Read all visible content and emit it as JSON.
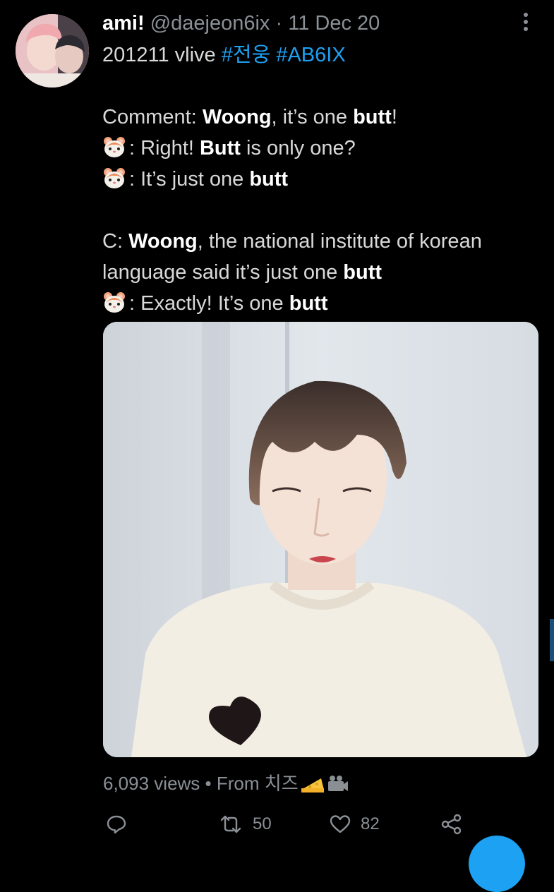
{
  "tweet": {
    "display_name": "ami!",
    "handle": "@daejeon6ix",
    "separator": "·",
    "date": "11 Dec 20",
    "line1_prefix": "201211 vlive",
    "hashtag1": "#전웅",
    "hashtag2": "#AB6IX",
    "dialogue1": {
      "comment_label": "Comment:",
      "comment_name": "Woong",
      "comment_mid": ", it’s one",
      "comment_word": "butt",
      "comment_end": "!",
      "reply1_pre": ": Right!",
      "reply1_word": "Butt",
      "reply1_post": "is only one?",
      "reply2_pre": ": It’s just one",
      "reply2_word": "butt"
    },
    "dialogue2": {
      "c_label": "C:",
      "c_name": "Woong",
      "c_rest": ", the national institute of korean",
      "c_line2_pre": "language said it’s just one",
      "c_line2_word": "butt",
      "reply_pre": ": Exactly! It’s one",
      "reply_word": "butt"
    },
    "reply_emoji": "hamster-face-icon"
  },
  "meta": {
    "views": "6,093 views",
    "bullet": "•",
    "source_prefix": "From",
    "source_name": "치즈",
    "source_icons": [
      "cheese-icon",
      "movie-camera-icon"
    ]
  },
  "actions": {
    "retweet_count": "50",
    "like_count": "82"
  },
  "colors": {
    "background": "#000000",
    "text": "#d9d9d9",
    "secondary": "#8b9096",
    "accent": "#1da1f2"
  }
}
